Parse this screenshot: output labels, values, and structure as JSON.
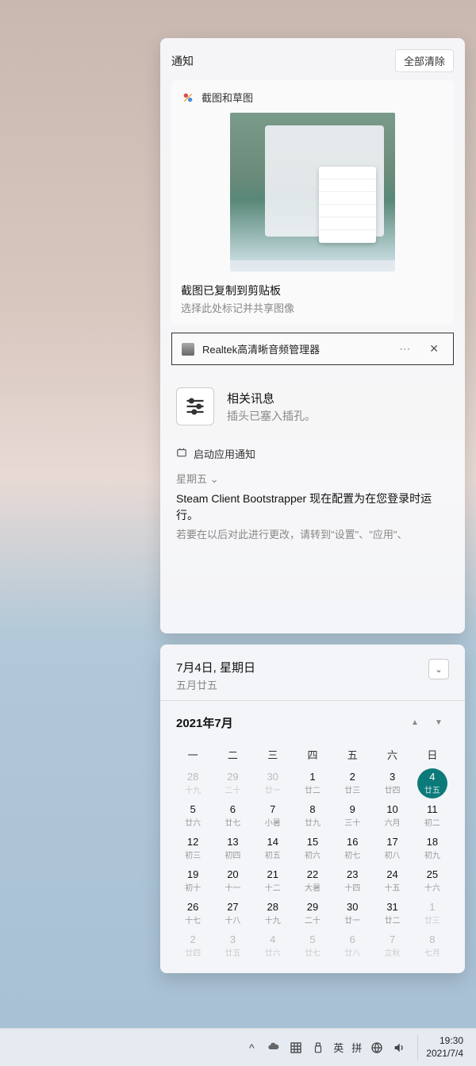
{
  "notifications": {
    "header_title": "通知",
    "clear_all": "全部清除",
    "snip": {
      "app_name": "截图和草图",
      "icon": "snip-sketch-icon",
      "message_title": "截图已复制到剪贴板",
      "message_sub": "选择此处标记并共享图像"
    },
    "realtek": {
      "app_name": "Realtek高清晰音频管理器",
      "info_title": "相关讯息",
      "info_sub": "插头已塞入插孔。"
    },
    "startup": {
      "section_title": "启动应用通知",
      "day": "星期五",
      "title": "Steam Client Bootstrapper 现在配置为在您登录时运行。",
      "sub": "若要在以后对此进行更改，请转到\"设置\"、\"应用\"、"
    }
  },
  "calendar": {
    "date_main": "7月4日, 星期日",
    "date_sub": "五月廿五",
    "month_label": "2021年7月",
    "dow": [
      "一",
      "二",
      "三",
      "四",
      "五",
      "六",
      "日"
    ],
    "weeks": [
      [
        {
          "n": "28",
          "l": "十九",
          "other": true
        },
        {
          "n": "29",
          "l": "二十",
          "other": true
        },
        {
          "n": "30",
          "l": "廿一",
          "other": true
        },
        {
          "n": "1",
          "l": "廿二"
        },
        {
          "n": "2",
          "l": "廿三"
        },
        {
          "n": "3",
          "l": "廿四"
        },
        {
          "n": "4",
          "l": "廿五",
          "today": true
        }
      ],
      [
        {
          "n": "5",
          "l": "廿六"
        },
        {
          "n": "6",
          "l": "廿七"
        },
        {
          "n": "7",
          "l": "小暑"
        },
        {
          "n": "8",
          "l": "廿九"
        },
        {
          "n": "9",
          "l": "三十"
        },
        {
          "n": "10",
          "l": "六月"
        },
        {
          "n": "11",
          "l": "初二"
        }
      ],
      [
        {
          "n": "12",
          "l": "初三"
        },
        {
          "n": "13",
          "l": "初四"
        },
        {
          "n": "14",
          "l": "初五"
        },
        {
          "n": "15",
          "l": "初六"
        },
        {
          "n": "16",
          "l": "初七"
        },
        {
          "n": "17",
          "l": "初八"
        },
        {
          "n": "18",
          "l": "初九"
        }
      ],
      [
        {
          "n": "19",
          "l": "初十"
        },
        {
          "n": "20",
          "l": "十一"
        },
        {
          "n": "21",
          "l": "十二"
        },
        {
          "n": "22",
          "l": "大暑"
        },
        {
          "n": "23",
          "l": "十四"
        },
        {
          "n": "24",
          "l": "十五"
        },
        {
          "n": "25",
          "l": "十六"
        }
      ],
      [
        {
          "n": "26",
          "l": "十七"
        },
        {
          "n": "27",
          "l": "十八"
        },
        {
          "n": "28",
          "l": "十九"
        },
        {
          "n": "29",
          "l": "二十"
        },
        {
          "n": "30",
          "l": "廿一"
        },
        {
          "n": "31",
          "l": "廿二"
        },
        {
          "n": "1",
          "l": "廿三",
          "other": true
        }
      ],
      [
        {
          "n": "2",
          "l": "廿四",
          "other": true
        },
        {
          "n": "3",
          "l": "廿五",
          "other": true
        },
        {
          "n": "4",
          "l": "廿六",
          "other": true
        },
        {
          "n": "5",
          "l": "廿七",
          "other": true
        },
        {
          "n": "6",
          "l": "廿八",
          "other": true
        },
        {
          "n": "7",
          "l": "立秋",
          "other": true
        },
        {
          "n": "8",
          "l": "七月",
          "other": true
        }
      ]
    ]
  },
  "taskbar": {
    "ime1": "英",
    "ime2": "拼",
    "time": "19:30",
    "date": "2021/7/4"
  }
}
